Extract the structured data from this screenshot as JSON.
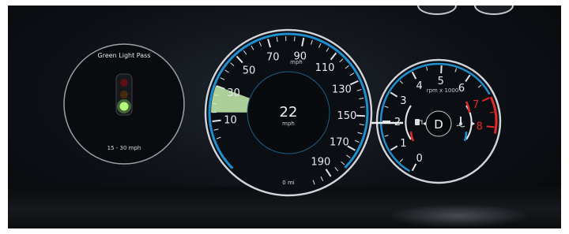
{
  "left_panel": {
    "title": "Green Light Pass",
    "range": "15 - 30 mph",
    "signal_active": "green"
  },
  "speedometer": {
    "current_speed": "22",
    "unit": "mph",
    "scale_unit": "mph",
    "odometer": "0 mi",
    "ticks": [
      "10",
      "30",
      "50",
      "70",
      "90",
      "110",
      "130",
      "150",
      "170",
      "190"
    ],
    "green_band_from": 15,
    "green_band_to": 30
  },
  "tachometer": {
    "unit": "rpm x 1000",
    "gear": "D",
    "ticks": [
      "0",
      "1",
      "2",
      "3",
      "4",
      "5",
      "6",
      "7",
      "8"
    ],
    "redline_from": 7
  },
  "colors": {
    "accent_blue": "#1e8fd0",
    "signal_green": "#9ff069",
    "redline": "#e12a2a",
    "green_band": "#c9f0b0"
  },
  "icons": {
    "fuel": "fuel-pump-icon",
    "coolant": "coolant-temperature-icon"
  }
}
